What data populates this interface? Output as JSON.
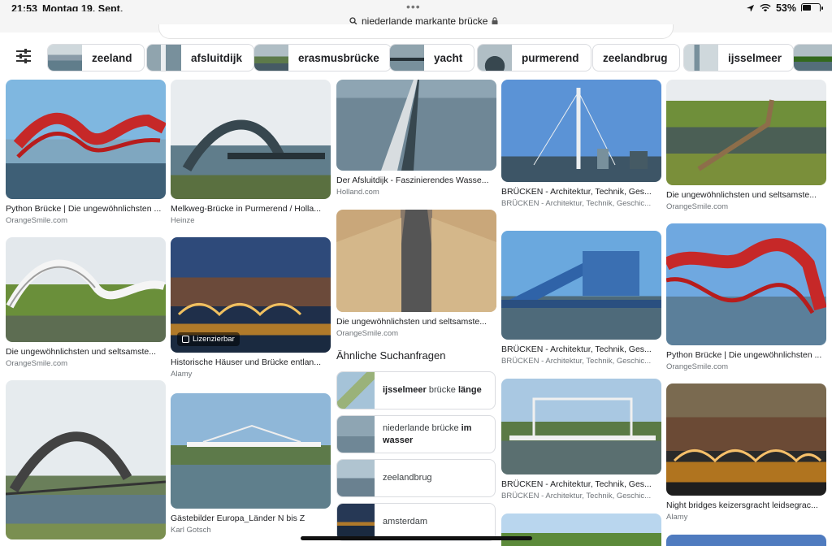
{
  "status": {
    "time": "21:53",
    "date": "Montag 19. Sept.",
    "battery": "53%",
    "battery_level": 0.53
  },
  "urlbar": {
    "url": "niederlande markante brücke"
  },
  "chips": [
    {
      "label": "zeeland"
    },
    {
      "label": "afsluitdijk"
    },
    {
      "label": "erasmusbrücke"
    },
    {
      "label": "yacht"
    },
    {
      "label": "purmerend"
    },
    {
      "label": "zeelandbrug"
    },
    {
      "label": "ijsselmeer"
    }
  ],
  "col1": [
    {
      "title": "Python Brücke | Die ungewöhnlichsten ...",
      "source": "OrangeSmile.com"
    },
    {
      "title": "Die ungewöhnlichsten und seltsamste...",
      "source": "OrangeSmile.com"
    },
    {
      "title": "",
      "source": ""
    }
  ],
  "col2": [
    {
      "title": "Melkweg-Brücke in Purmerend / Holla...",
      "source": "Heinze"
    },
    {
      "title": "Historische Häuser und Brücke entlan...",
      "source": "Alamy",
      "badge": "Lizenzierbar"
    },
    {
      "title": "Gästebilder Europa_Länder N bis Z",
      "source": "Karl Gotsch"
    }
  ],
  "col3": [
    {
      "title": "Der Afsluitdijk - Faszinierendes Wasse...",
      "source": "Holland.com"
    },
    {
      "title": "Die ungewöhnlichsten und seltsamste...",
      "source": "OrangeSmile.com"
    }
  ],
  "col4": [
    {
      "title": "BRÜCKEN - Architektur, Technik, Ges...",
      "source": "BRÜCKEN - Architektur, Technik, Geschic..."
    },
    {
      "title": "BRÜCKEN - Architektur, Technik, Ges...",
      "source": "BRÜCKEN - Architektur, Technik, Geschic..."
    },
    {
      "title": "BRÜCKEN - Architektur, Technik, Ges...",
      "source": "BRÜCKEN - Architektur, Technik, Geschic..."
    }
  ],
  "col5": [
    {
      "title": "Die ungewöhnlichsten und seltsamste...",
      "source": "OrangeSmile.com"
    },
    {
      "title": "Python Brücke | Die ungewöhnlichsten ...",
      "source": "OrangeSmile.com"
    },
    {
      "title": "Night bridges keizersgracht leidsegrac...",
      "source": "Alamy"
    }
  ],
  "related": {
    "heading": "Ähnliche Suchanfragen",
    "items": [
      {
        "pre": "ijsselmeer",
        "mid": " brücke ",
        "bold": "länge"
      },
      {
        "pre": "niederlande brücke ",
        "mid": "",
        "bold": "im wasser"
      },
      {
        "pre": "zeelandbrug",
        "mid": "",
        "bold": ""
      },
      {
        "pre": "amsterdam",
        "mid": "",
        "bold": ""
      }
    ]
  }
}
